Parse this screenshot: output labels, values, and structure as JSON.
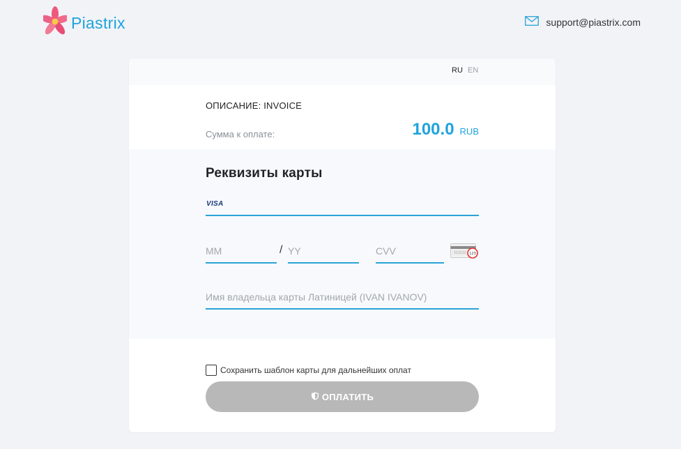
{
  "header": {
    "logo_text": "Piastrix",
    "support_email": "support@piastrix.com",
    "mail_icon": "mail-icon",
    "logo_icon": "flower-logo-icon"
  },
  "lang": {
    "ru": "RU",
    "en": "EN",
    "active": "RU"
  },
  "invoice": {
    "description": "ОПИСАНИЕ: INVOICE",
    "sum_label": "Сумма к оплате:",
    "amount": "100.0",
    "currency": "RUB"
  },
  "form": {
    "title": "Реквизиты карты",
    "card_brand": "VISA",
    "card_number_value": "",
    "month_placeholder": "MM",
    "separator": "/",
    "year_placeholder": "YY",
    "cvv_placeholder": "CVV",
    "cvv_hint_text": "123",
    "holder_placeholder": "Имя владельца карты Латиницей (IVAN IVANOV)",
    "save_template_label": "Сохранить шаблон карты для дальнейших оплат",
    "save_template_checked": false,
    "pay_button_label": "ОПЛАТИТЬ",
    "pay_button_icon": "shield-icon"
  },
  "colors": {
    "accent": "#1fa3dc",
    "field_underline": "#2aa3d6",
    "button_disabled": "#b8b8b8",
    "cvv_highlight": "#e0322b"
  }
}
